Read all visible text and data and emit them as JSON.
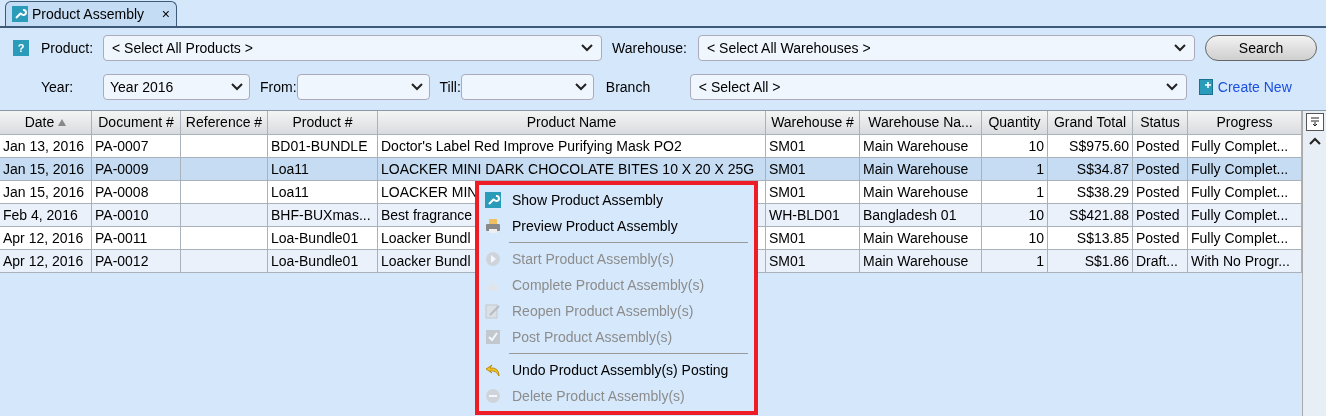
{
  "tab": {
    "title": "Product Assembly",
    "close": "×",
    "selected": true
  },
  "filters": {
    "help": "?",
    "product_label": "Product:",
    "product": "< Select All Products >",
    "warehouse_label": "Warehouse:",
    "warehouse": "< Select All Warehouses >",
    "search_button": "Search",
    "year_label": "Year:",
    "year": "Year 2016",
    "from_label": "From:",
    "till_label": "Till:",
    "branch_label": "Branch",
    "branch": "< Select All >",
    "create_new": "Create New"
  },
  "table": {
    "columns": [
      {
        "label": "Date",
        "sorted": true
      },
      {
        "label": "Document #",
        "sorted": false
      },
      {
        "label": "Reference #",
        "sorted": false
      },
      {
        "label": "Product #",
        "sorted": false
      },
      {
        "label": "Product Name",
        "sorted": false
      },
      {
        "label": "Warehouse #",
        "sorted": false
      },
      {
        "label": "Warehouse Na...",
        "sorted": false
      },
      {
        "label": "Quantity",
        "sorted": false
      },
      {
        "label": "Grand Total",
        "sorted": false
      },
      {
        "label": "Status",
        "sorted": false
      },
      {
        "label": "Progress",
        "sorted": false
      }
    ],
    "rows": [
      {
        "selected": false,
        "cells": [
          "Jan 13, 2016",
          "PA-0007",
          "",
          "BD01-BUNDLE",
          "Doctor's Label Red Improve Purifying Mask PO2",
          "SM01",
          "Main Warehouse",
          "10",
          "S$975.60",
          "Posted",
          "Fully Complet..."
        ]
      },
      {
        "selected": true,
        "cells": [
          "Jan 15, 2016",
          "PA-0009",
          "",
          "Loa11",
          "LOACKER MINI DARK CHOCOLATE BITES 10 X 20 X 25G",
          "SM01",
          "Main Warehouse",
          "1",
          "S$34.87",
          "Posted",
          "Fully Complet..."
        ]
      },
      {
        "selected": false,
        "cells": [
          "Jan 15, 2016",
          "PA-0008",
          "",
          "Loa11",
          "LOACKER MIN",
          "SM01",
          "Main Warehouse",
          "1",
          "S$38.29",
          "Posted",
          "Fully Complet..."
        ]
      },
      {
        "selected": false,
        "cells": [
          "Feb 4, 2016",
          "PA-0010",
          "",
          "BHF-BUXmas...",
          "Best fragrance",
          "WH-BLD01",
          "Bangladesh 01",
          "10",
          "S$421.88",
          "Posted",
          "Fully Complet..."
        ]
      },
      {
        "selected": false,
        "cells": [
          "Apr 12, 2016",
          "PA-0011",
          "",
          "Loa-Bundle01",
          "Loacker Bundl",
          "SM01",
          "Main Warehouse",
          "10",
          "S$13.85",
          "Posted",
          "Fully Complet..."
        ]
      },
      {
        "selected": false,
        "cells": [
          "Apr 12, 2016",
          "PA-0012",
          "",
          "Loa-Bundle01",
          "Loacker Bundl",
          "SM01",
          "Main Warehouse",
          "1",
          "S$1.86",
          "Draft...",
          "With No Progr..."
        ]
      }
    ]
  },
  "context_menu": {
    "groups": [
      [
        {
          "label": "Show Product Assembly",
          "disabled": false
        },
        {
          "label": "Preview Product Assembly",
          "disabled": false
        }
      ],
      [
        {
          "label": "Start Product Assembly(s)",
          "disabled": true
        },
        {
          "label": "Complete Product Assembly(s)",
          "disabled": true
        },
        {
          "label": "Reopen Product Assembly(s)",
          "disabled": true
        },
        {
          "label": "Post Product Assembly(s)",
          "disabled": true
        }
      ],
      [
        {
          "label": "Undo Product Assembly(s) Posting",
          "disabled": false
        },
        {
          "label": "Delete Product Assembly(s)",
          "disabled": true
        }
      ]
    ]
  }
}
